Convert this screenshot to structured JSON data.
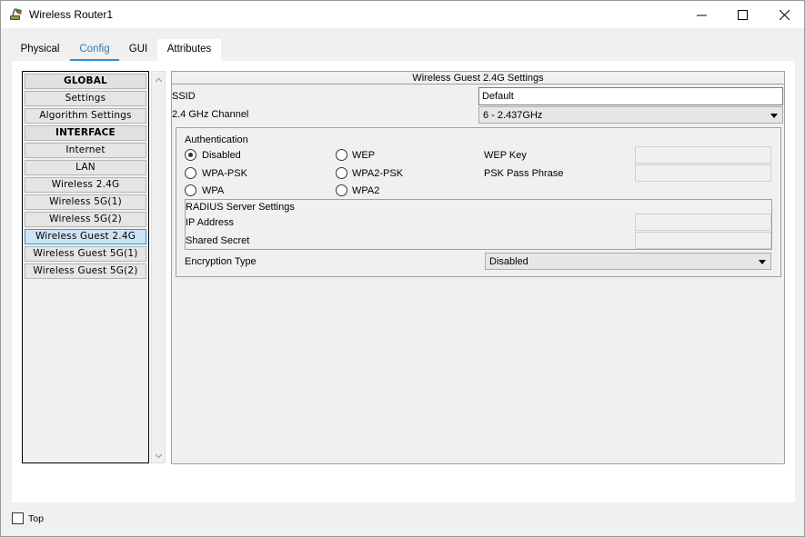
{
  "window": {
    "title": "Wireless Router1"
  },
  "tabs": [
    {
      "label": "Physical"
    },
    {
      "label": "Config"
    },
    {
      "label": "GUI"
    },
    {
      "label": "Attributes"
    }
  ],
  "sidebar": {
    "items": [
      {
        "label": "GLOBAL"
      },
      {
        "label": "Settings"
      },
      {
        "label": "Algorithm Settings"
      },
      {
        "label": "INTERFACE"
      },
      {
        "label": "Internet"
      },
      {
        "label": "LAN"
      },
      {
        "label": "Wireless 2.4G"
      },
      {
        "label": "Wireless 5G(1)"
      },
      {
        "label": "Wireless 5G(2)"
      },
      {
        "label": "Wireless Guest 2.4G"
      },
      {
        "label": "Wireless Guest 5G(1)"
      },
      {
        "label": "Wireless Guest 5G(2)"
      }
    ]
  },
  "panel": {
    "title": "Wireless Guest 2.4G Settings",
    "ssid_label": "SSID",
    "ssid_value": "Default",
    "channel_label": "2.4 GHz Channel",
    "channel_value": "6 - 2.437GHz",
    "auth": {
      "label": "Authentication",
      "options": {
        "disabled": "Disabled",
        "wep": "WEP",
        "wpa_psk": "WPA-PSK",
        "wpa2_psk": "WPA2-PSK",
        "wpa": "WPA",
        "wpa2": "WPA2"
      },
      "selected": "Disabled",
      "wep_key_label": "WEP Key",
      "psk_label": "PSK Pass Phrase"
    },
    "radius": {
      "label": "RADIUS Server Settings",
      "ip_label": "IP Address",
      "secret_label": "Shared Secret"
    },
    "encryption_label": "Encryption Type",
    "encryption_value": "Disabled"
  },
  "footer": {
    "top_label": "Top"
  }
}
